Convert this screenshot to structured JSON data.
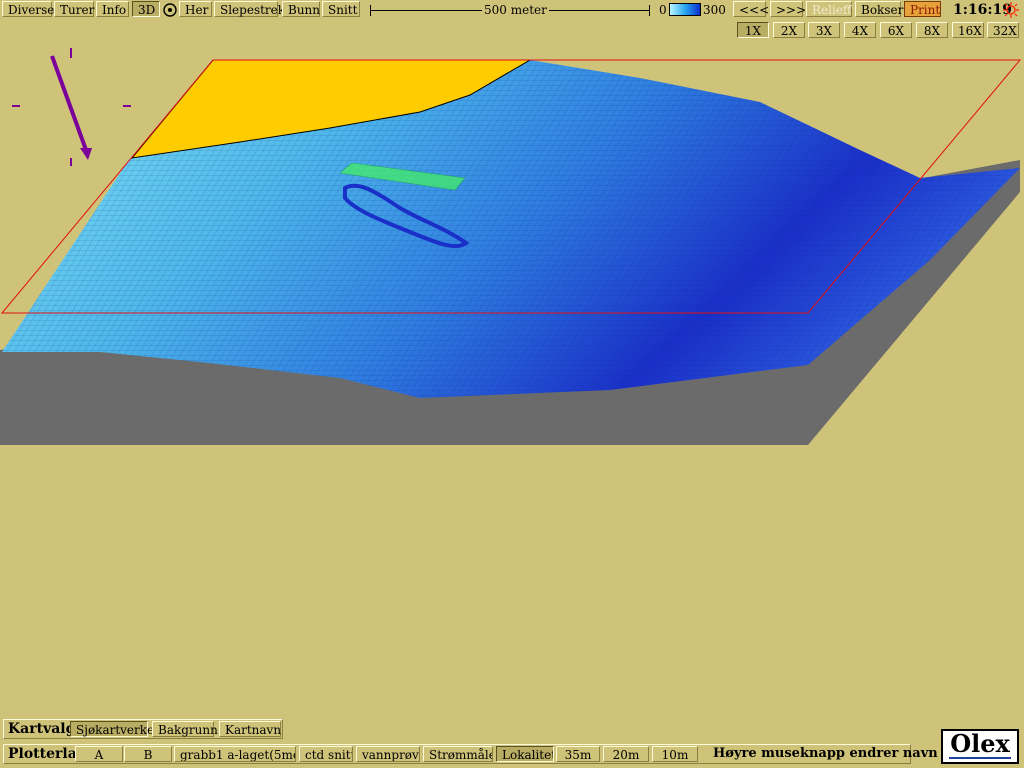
{
  "toolbar": {
    "diverse": "Diverse",
    "turer": "Turer",
    "info": "Info",
    "mode_3d": "3D",
    "her": "Her",
    "slepestrek": "Slepestrek",
    "bunn": "Bunn",
    "snitt": "Snitt",
    "scale_label": "500 meter",
    "depth_min": "0",
    "depth_max": "300",
    "prev": "<<<",
    "next": ">>>",
    "relieff": "Relieff",
    "bokser": "Bokser",
    "print": "Print",
    "clock": "1:16:19"
  },
  "zoom": [
    "1X",
    "2X",
    "3X",
    "4X",
    "6X",
    "8X",
    "16X",
    "32X"
  ],
  "zoom_selected": "1X",
  "kartvalg": {
    "title": "Kartvalg",
    "items": [
      "Sjøkartverket",
      "Bakgrunn",
      "Kartnavn"
    ],
    "selected": "Sjøkartverket"
  },
  "plotterlag": {
    "title": "Plotterlag",
    "items": [
      "A",
      "B",
      "grabb1 a-laget(5mete",
      "ctd snitt",
      "vannprøve",
      "Strømmåler",
      "Lokalitet",
      "35m",
      "20m",
      "10m"
    ],
    "selected": "Lokalitet",
    "hint": "Høyre museknapp endrer navn"
  },
  "logo": "Olex",
  "colors": {
    "background": "#cfc37a",
    "terrain_light": "#7fe0f0",
    "terrain_dark": "#1a2fc8",
    "land": "#ffcc00",
    "frame": "#e01010",
    "base": "#6b6b6b",
    "marker": "#44ee66",
    "north_arrow": "#7a0099"
  },
  "icons": {
    "her": "target-icon",
    "sun": "sun-icon",
    "north": "north-arrow-icon"
  }
}
